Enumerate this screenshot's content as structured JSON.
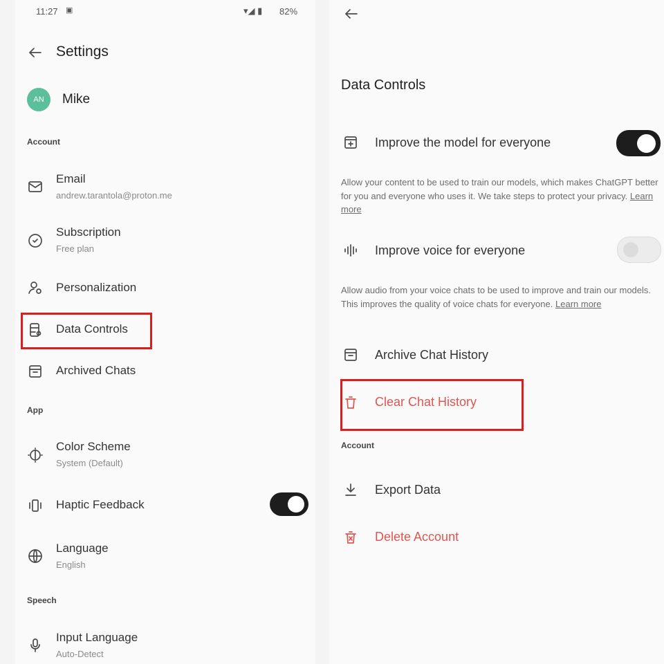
{
  "status_bar": {
    "time": "11:27",
    "battery": "82%"
  },
  "settings": {
    "title": "Settings",
    "profile": {
      "initials": "AN",
      "name": "Mike"
    },
    "sections": {
      "account": "Account",
      "app": "App",
      "speech": "Speech"
    },
    "items": {
      "email": {
        "label": "Email",
        "sub": "andrew.tarantola@proton.me"
      },
      "subscription": {
        "label": "Subscription",
        "sub": "Free plan"
      },
      "personalization": {
        "label": "Personalization"
      },
      "data_controls": {
        "label": "Data Controls"
      },
      "archived_chats": {
        "label": "Archived Chats"
      },
      "color_scheme": {
        "label": "Color Scheme",
        "sub": "System (Default)"
      },
      "haptic_feedback": {
        "label": "Haptic Feedback",
        "enabled": true
      },
      "language": {
        "label": "Language",
        "sub": "English"
      },
      "input_language": {
        "label": "Input Language",
        "sub": "Auto-Detect"
      }
    }
  },
  "data_controls": {
    "title": "Data Controls",
    "improve_model": {
      "label": "Improve the model for everyone",
      "enabled": true,
      "description": "Allow your content to be used to train our models, which makes ChatGPT better for you and everyone who uses it. We take steps to protect your privacy.",
      "link": "Learn more"
    },
    "improve_voice": {
      "label": "Improve voice for everyone",
      "enabled": false,
      "description": "Allow audio from your voice chats to be used to improve and train our models. This improves the quality of voice chats for everyone.",
      "link": "Learn more"
    },
    "archive_chat_history": "Archive Chat History",
    "clear_chat_history": "Clear Chat History",
    "account_section": "Account",
    "export_data": "Export Data",
    "delete_account": "Delete Account"
  },
  "colors": {
    "accent_red": "#e0554f",
    "highlight_red": "#d6201f",
    "avatar": "#5bbf9b",
    "toggle_on": "#1d1d1d"
  }
}
